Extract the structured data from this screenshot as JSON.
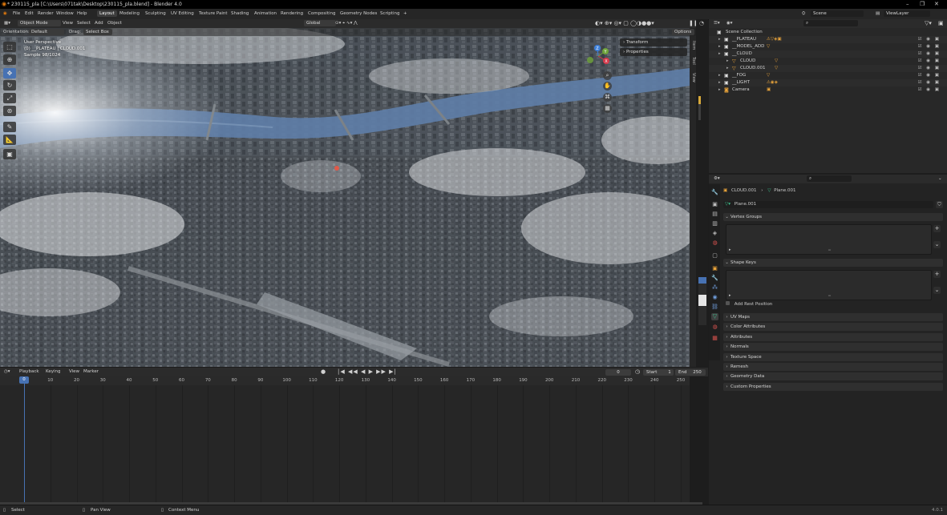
{
  "window": {
    "title": "* 230115_pla [C:\\Users\\071tak\\Desktop\\230115_pla.blend] - Blender 4.0"
  },
  "menu": [
    "File",
    "Edit",
    "Render",
    "Window",
    "Help"
  ],
  "workspaces": [
    "Layout",
    "Modeling",
    "Sculpting",
    "UV Editing",
    "Texture Paint",
    "Shading",
    "Animation",
    "Rendering",
    "Compositing",
    "Geometry Nodes",
    "Scripting"
  ],
  "active_workspace": "Layout",
  "scene": {
    "name": "Scene",
    "view_layer": "ViewLayer"
  },
  "viewport": {
    "mode": "Object Mode",
    "menus": [
      "View",
      "Select",
      "Add",
      "Object"
    ],
    "transform_orientation": "Global",
    "orientation_label": "Orientation:",
    "orientation_value": "Default",
    "drag_label": "Drag:",
    "drag_value": "Select Box",
    "options_label": "Options",
    "overlay_line1": "User Perspective",
    "overlay_line2": "(0) __PLATEAU | CLOUD.001",
    "overlay_line3": "Sample 98/1024",
    "npanel": [
      "Transform",
      "Properties"
    ],
    "side_tabs": [
      "Item",
      "Tool",
      "View"
    ],
    "gizmo_axes": {
      "x": "X",
      "y": "Y",
      "z": "Z"
    },
    "colors": {
      "x_axis": "#d6394b",
      "y_axis": "#6ea23a",
      "z_axis": "#3d7fd8",
      "water": "#5c7ba8"
    }
  },
  "timeline": {
    "menus": [
      "Playback",
      "Keying",
      "View",
      "Marker"
    ],
    "current_frame": "0",
    "start_label": "Start",
    "start": "1",
    "end_label": "End",
    "end": "250",
    "ticks": [
      "0",
      "10",
      "20",
      "30",
      "40",
      "50",
      "60",
      "70",
      "80",
      "90",
      "100",
      "110",
      "120",
      "130",
      "140",
      "150",
      "160",
      "170",
      "180",
      "190",
      "200",
      "210",
      "220",
      "230",
      "240",
      "250"
    ]
  },
  "outliner": {
    "root": "Scene Collection",
    "items": [
      {
        "name": "__PLATEAU",
        "indent": 1,
        "icon": "collection-icon",
        "extras": "⚠▽◈▣"
      },
      {
        "name": "__MODEL_ADD",
        "indent": 1,
        "icon": "collection-icon",
        "extras": "▽"
      },
      {
        "name": "__CLOUD",
        "indent": 1,
        "icon": "collection-icon",
        "extras": ""
      },
      {
        "name": "CLOUD",
        "indent": 2,
        "icon": "mesh-object-icon",
        "extras": "▽"
      },
      {
        "name": "CLOUD.001",
        "indent": 2,
        "icon": "mesh-object-icon",
        "extras": "▽"
      },
      {
        "name": "__FOG",
        "indent": 1,
        "icon": "collection-icon",
        "extras": "▽"
      },
      {
        "name": "__LIGHT",
        "indent": 1,
        "icon": "collection-icon",
        "extras": "⚠◉◈"
      },
      {
        "name": "Camera",
        "indent": 1,
        "icon": "camera-icon",
        "extras": "▣"
      }
    ]
  },
  "properties": {
    "object": "CLOUD.001",
    "mesh": "Plane.001",
    "mesh_field": "Plane.001",
    "panels_open": [
      "Vertex Groups",
      "Shape Keys"
    ],
    "add_rest_position": "Add Rest Position",
    "panels_closed": [
      "UV Maps",
      "Color Attributes",
      "Attributes",
      "Normals",
      "Texture Space",
      "Remesh",
      "Geometry Data",
      "Custom Properties"
    ]
  },
  "statusbar": {
    "select": "Select",
    "pan": "Pan View",
    "context": "Context Menu",
    "version": "4.0.1"
  }
}
